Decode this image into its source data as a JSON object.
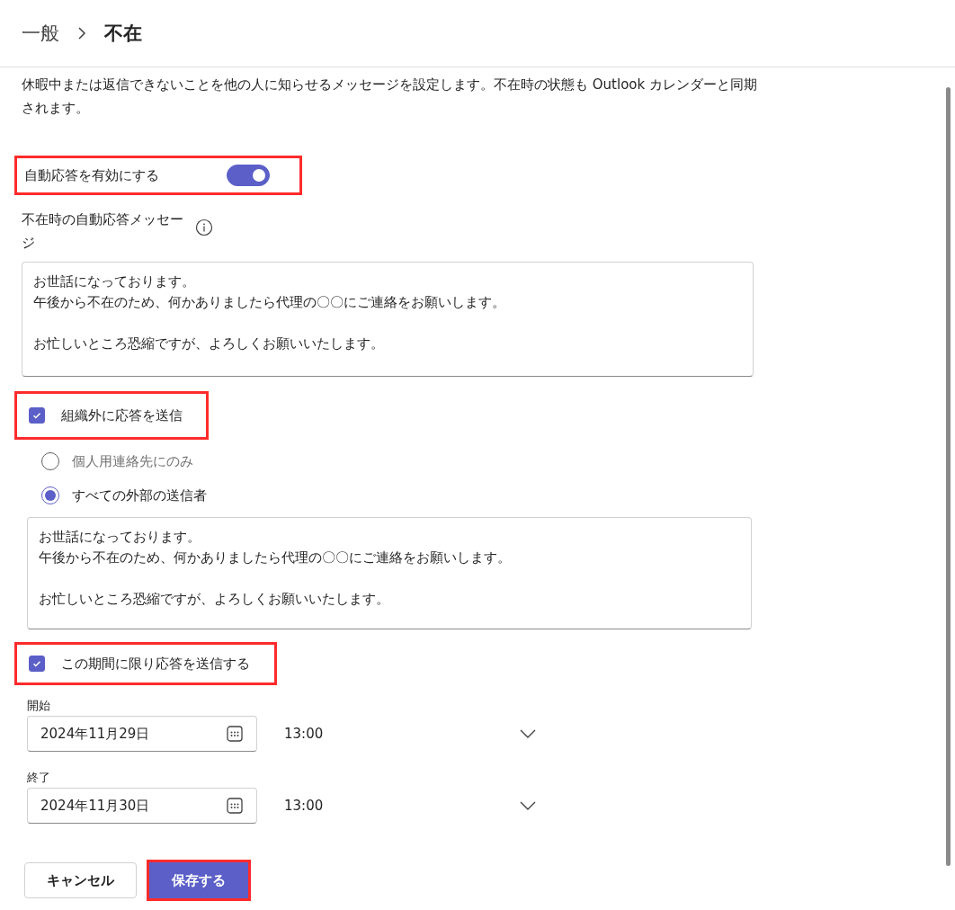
{
  "breadcrumb": [
    {
      "label": "一般",
      "current": false
    },
    {
      "label": "不在",
      "current": true
    }
  ],
  "description": "休暇中または返信できないことを他の人に知らせるメッセージを設定します。不在時の状態も Outlook カレンダーと同期されます。",
  "auto_reply": {
    "label": "自動応答を有効にする",
    "on": true,
    "highlighted": true
  },
  "internal_message": {
    "label": "不在時の自動応答メッセージ",
    "paragraphs": [
      [
        "お世話になっております。",
        "午後から不在のため、何かありましたら代理の〇〇にご連絡をお願いします。"
      ],
      [
        "お忙しいところ恐縮ですが、よろしくお願いいたします。"
      ]
    ]
  },
  "external": {
    "label": "組織外に応答を送信",
    "checked": true,
    "highlighted": true,
    "options": [
      {
        "label": "個人用連絡先にのみ",
        "selected": false
      },
      {
        "label": "すべての外部の送信者",
        "selected": true
      }
    ],
    "message_paragraphs": [
      [
        "お世話になっております。",
        "午後から不在のため、何かありましたら代理の〇〇にご連絡をお願いします。"
      ],
      [
        "お忙しいところ恐縮ですが、よろしくお願いいたします。"
      ]
    ]
  },
  "period": {
    "label": "この期間に限り応答を送信する",
    "checked": true,
    "highlighted": true,
    "ranges": [
      {
        "label": "開始",
        "date": "2024年11月29日",
        "time": "13:00"
      },
      {
        "label": "終了",
        "date": "2024年11月30日",
        "time": "13:00"
      }
    ]
  },
  "buttons": [
    {
      "label": "キャンセル",
      "kind": "secondary",
      "highlighted": false
    },
    {
      "label": "保存する",
      "kind": "primary",
      "highlighted": true
    }
  ]
}
